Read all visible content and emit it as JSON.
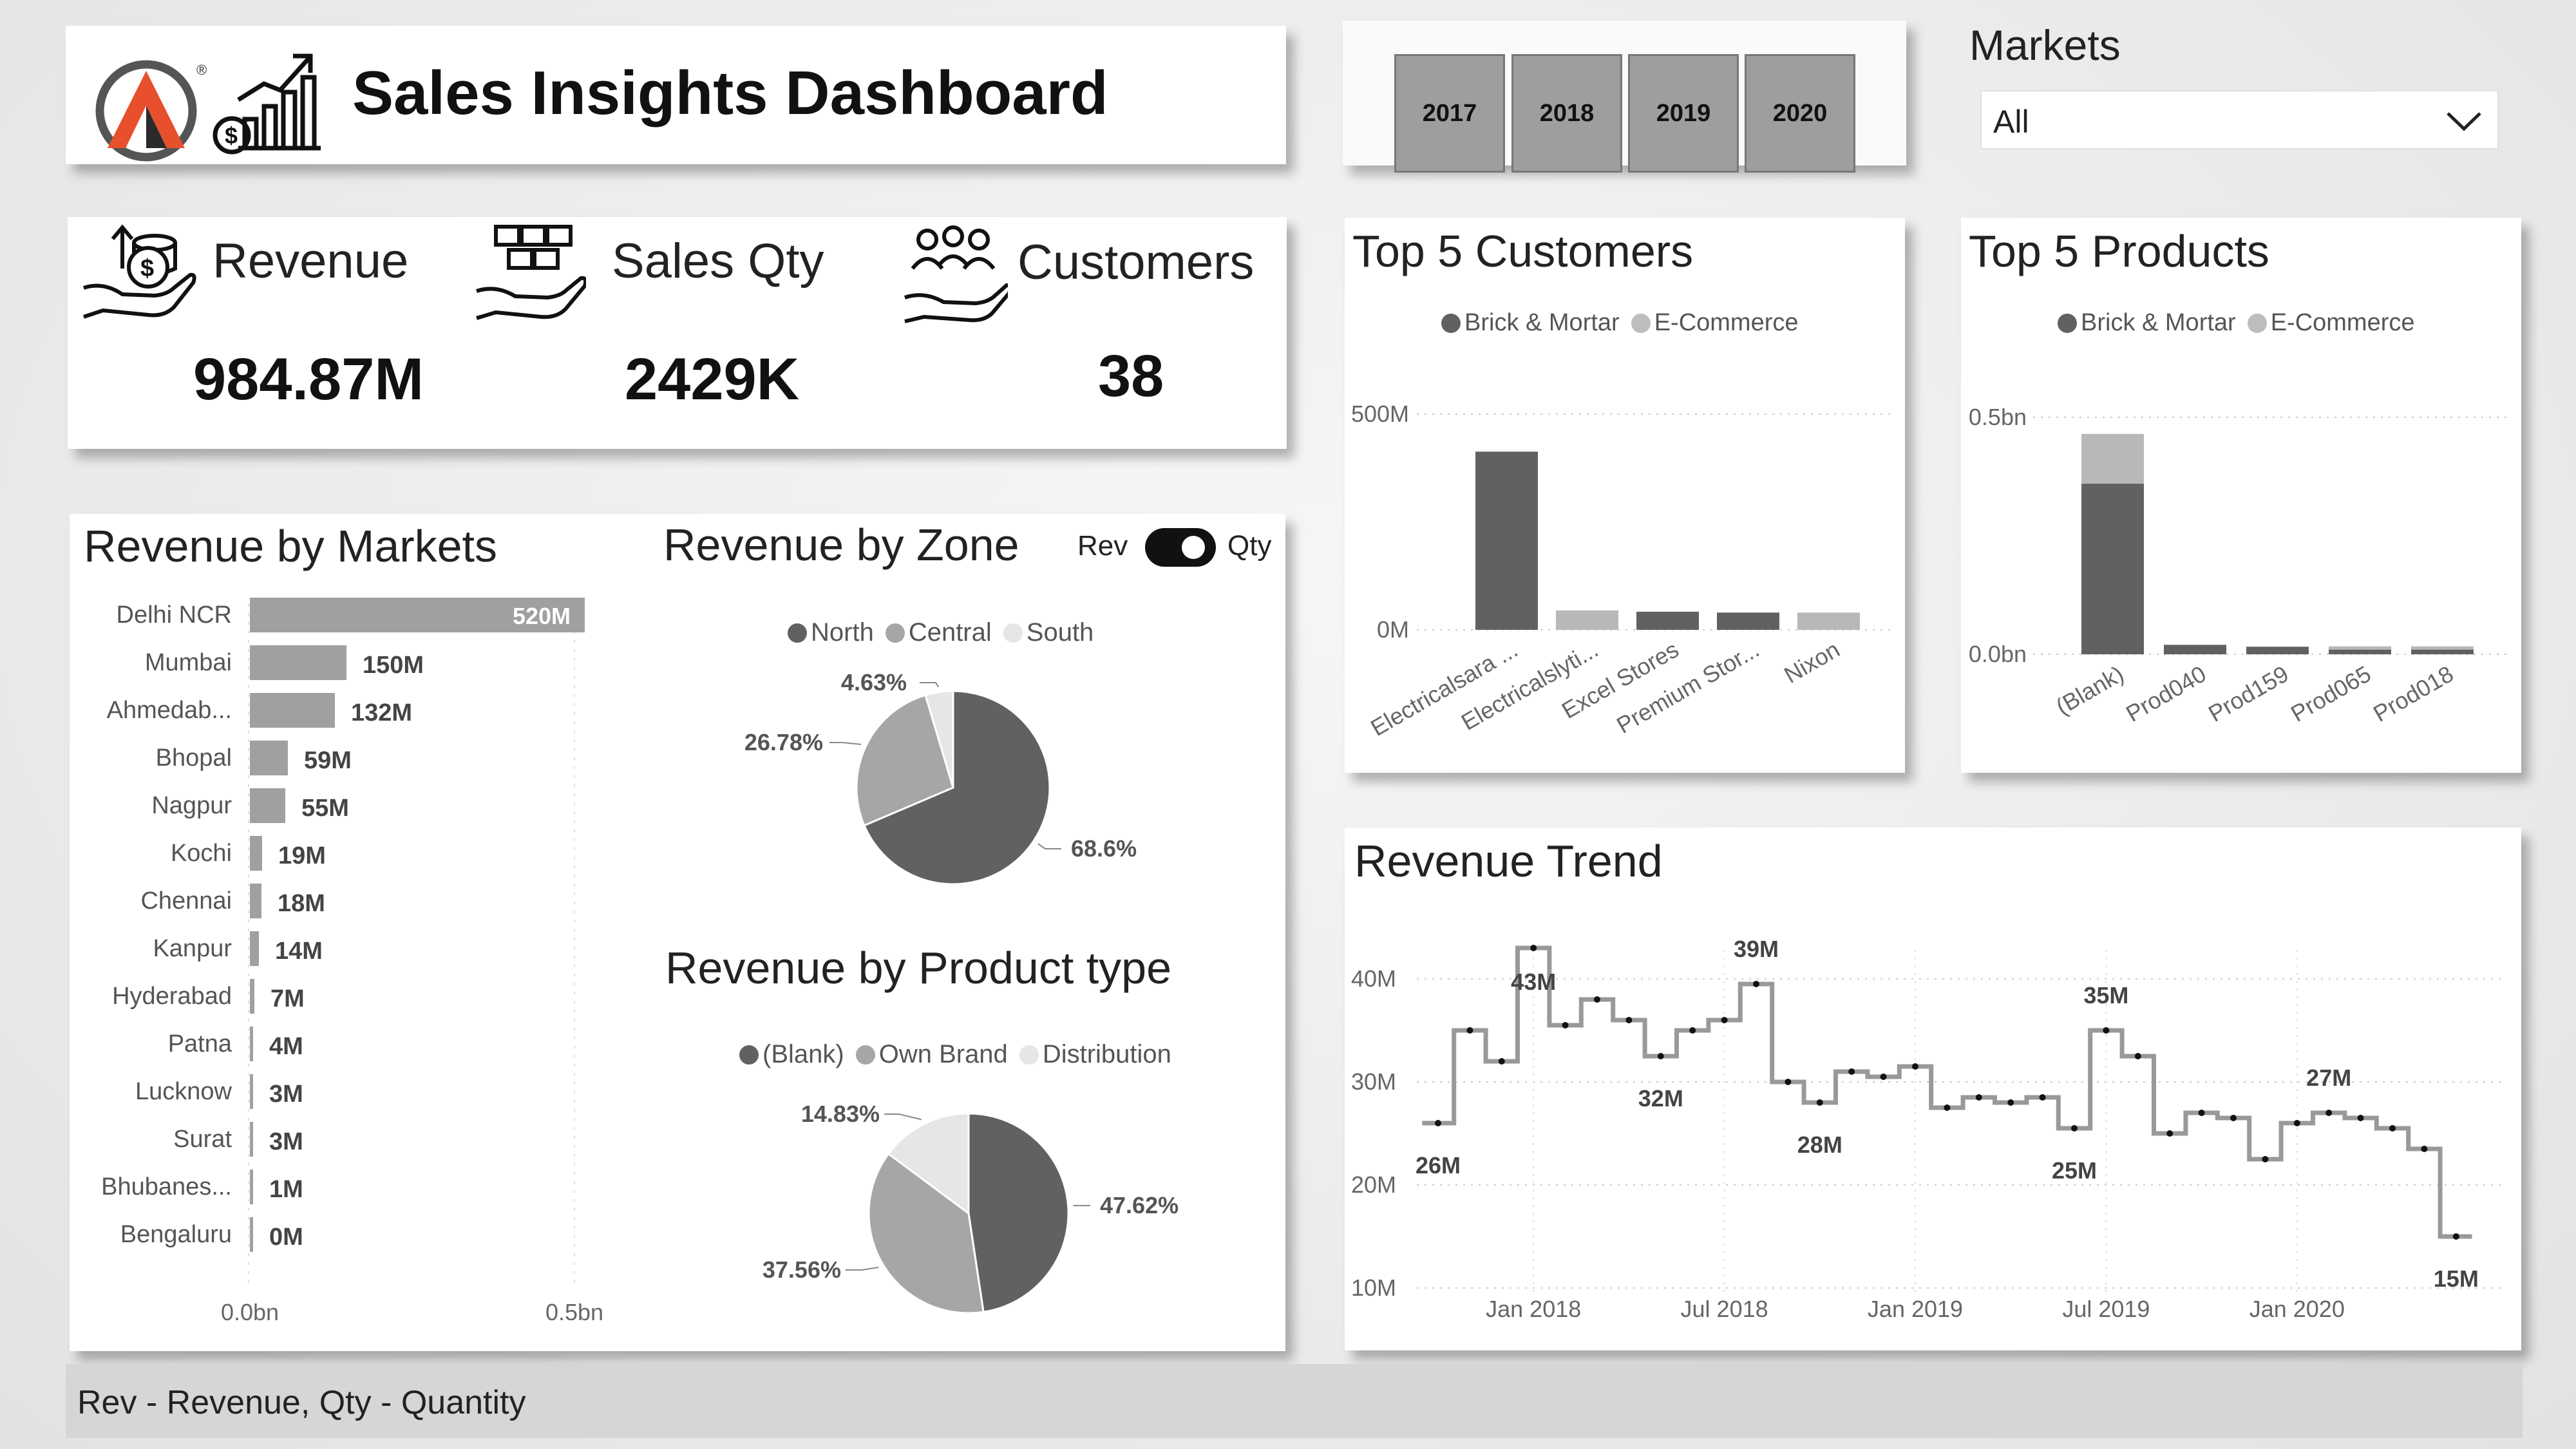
{
  "header": {
    "title": "Sales Insights Dashboard"
  },
  "years": [
    "2017",
    "2018",
    "2019",
    "2020"
  ],
  "markets_filter": {
    "label": "Markets",
    "value": "All"
  },
  "kpis": {
    "revenue": {
      "label": "Revenue",
      "value": "984.87M"
    },
    "sales_qty": {
      "label": "Sales Qty",
      "value": "2429K"
    },
    "customers": {
      "label": "Customers",
      "value": "38"
    }
  },
  "top_customers": {
    "title": "Top 5 Customers",
    "legend": [
      "Brick & Mortar",
      "E-Commerce"
    ],
    "y_ticks": [
      "500M",
      "0M"
    ]
  },
  "top_products": {
    "title": "Top 5 Products",
    "legend": [
      "Brick & Mortar",
      "E-Commerce"
    ],
    "y_ticks": [
      "0.5bn",
      "0.0bn"
    ]
  },
  "revenue_by_markets": {
    "title": "Revenue by Markets",
    "x_ticks": [
      "0.0bn",
      "0.5bn"
    ]
  },
  "revenue_by_zone": {
    "title": "Revenue by Zone",
    "toggle": {
      "left": "Rev",
      "right": "Qty"
    },
    "legend": [
      "North",
      "Central",
      "South"
    ]
  },
  "revenue_by_product_type": {
    "title": "Revenue by Product type",
    "legend": [
      "(Blank)",
      "Own Brand",
      "Distribution"
    ]
  },
  "revenue_trend": {
    "title": "Revenue Trend"
  },
  "footer": {
    "text": "Rev - Revenue, Qty - Quantity"
  },
  "colors": {
    "dark": "#616161",
    "mid": "#a6a6a6",
    "light": "#e6e6e6"
  },
  "chart_data": [
    {
      "type": "bar",
      "orientation": "horizontal",
      "categories": [
        "Delhi NCR",
        "Mumbai",
        "Ahmedab...",
        "Bhopal",
        "Nagpur",
        "Kochi",
        "Chennai",
        "Kanpur",
        "Hyderabad",
        "Patna",
        "Lucknow",
        "Surat",
        "Bhubanes...",
        "Bengaluru"
      ],
      "values": [
        520,
        150,
        132,
        59,
        55,
        19,
        18,
        14,
        7,
        4,
        3,
        3,
        1,
        0
      ],
      "labels": [
        "520M",
        "150M",
        "132M",
        "59M",
        "55M",
        "19M",
        "18M",
        "14M",
        "7M",
        "4M",
        "3M",
        "3M",
        "1M",
        "0M"
      ],
      "unit": "M",
      "xlim": [
        0,
        520
      ]
    },
    {
      "type": "bar",
      "stacked": true,
      "categories": [
        "Electricalsara ...",
        "Electricalslyti...",
        "Excel Stores",
        "Premium Stor...",
        "Nixon"
      ],
      "series": [
        {
          "name": "Brick & Mortar",
          "values": [
            413,
            0,
            42,
            40,
            0
          ]
        },
        {
          "name": "E-Commerce",
          "values": [
            0,
            45,
            0,
            0,
            40
          ]
        }
      ],
      "ylim": [
        0,
        500
      ],
      "unit": "M"
    },
    {
      "type": "bar",
      "stacked": true,
      "categories": [
        "(Blank)",
        "Prod040",
        "Prod159",
        "Prod065",
        "Prod018"
      ],
      "series": [
        {
          "name": "Brick & Mortar",
          "values": [
            0.36,
            0.02,
            0.016,
            0.01,
            0.01
          ]
        },
        {
          "name": "E-Commerce",
          "values": [
            0.105,
            0,
            0,
            0.006,
            0.006
          ]
        }
      ],
      "ylim": [
        0,
        0.5
      ],
      "unit": "bn"
    },
    {
      "type": "pie",
      "labels": [
        "North",
        "Central",
        "South"
      ],
      "values": [
        68.6,
        26.78,
        4.63
      ],
      "value_labels": [
        "68.6%",
        "26.78%",
        "4.63%"
      ]
    },
    {
      "type": "pie",
      "labels": [
        "(Blank)",
        "Own Brand",
        "Distribution"
      ],
      "values": [
        47.62,
        37.56,
        14.83
      ],
      "value_labels": [
        "47.62%",
        "37.56%",
        "14.83%"
      ]
    },
    {
      "type": "line",
      "step": true,
      "x_ticks": [
        "Jan 2018",
        "Jul 2018",
        "Jan 2019",
        "Jul 2019",
        "Jan 2020"
      ],
      "y_ticks": [
        "40M",
        "30M",
        "20M",
        "10M"
      ],
      "ylim": [
        10,
        40
      ],
      "x": [
        "Oct 2017",
        "Nov 2017",
        "Dec 2017",
        "Jan 2018",
        "Feb 2018",
        "Mar 2018",
        "Apr 2018",
        "May 2018",
        "Jun 2018",
        "Jul 2018",
        "Aug 2018",
        "Sep 2018",
        "Oct 2018",
        "Nov 2018",
        "Dec 2018",
        "Jan 2019",
        "Feb 2019",
        "Mar 2019",
        "Apr 2019",
        "May 2019",
        "Jun 2019",
        "Jul 2019",
        "Aug 2019",
        "Sep 2019",
        "Oct 2019",
        "Nov 2019",
        "Dec 2019",
        "Jan 2020",
        "Feb 2020",
        "Mar 2020",
        "Apr 2020",
        "May 2020",
        "Jun 2020"
      ],
      "values": [
        26,
        35,
        32,
        43,
        35.5,
        38,
        36,
        32.5,
        35,
        36,
        39.5,
        30,
        28,
        31,
        30.5,
        31.5,
        27.5,
        28.5,
        28,
        28.5,
        25.5,
        35,
        32.5,
        25,
        27,
        26.5,
        22.5,
        26,
        27,
        26.5,
        25.5,
        23.5,
        15
      ],
      "point_labels": [
        {
          "index": 0,
          "text": "26M"
        },
        {
          "index": 3,
          "text": "43M"
        },
        {
          "index": 7,
          "text": "32M"
        },
        {
          "index": 10,
          "text": "39M"
        },
        {
          "index": 12,
          "text": "28M"
        },
        {
          "index": 20,
          "text": "25M"
        },
        {
          "index": 21,
          "text": "35M"
        },
        {
          "index": 28,
          "text": "27M"
        },
        {
          "index": 32,
          "text": "15M"
        }
      ]
    }
  ]
}
